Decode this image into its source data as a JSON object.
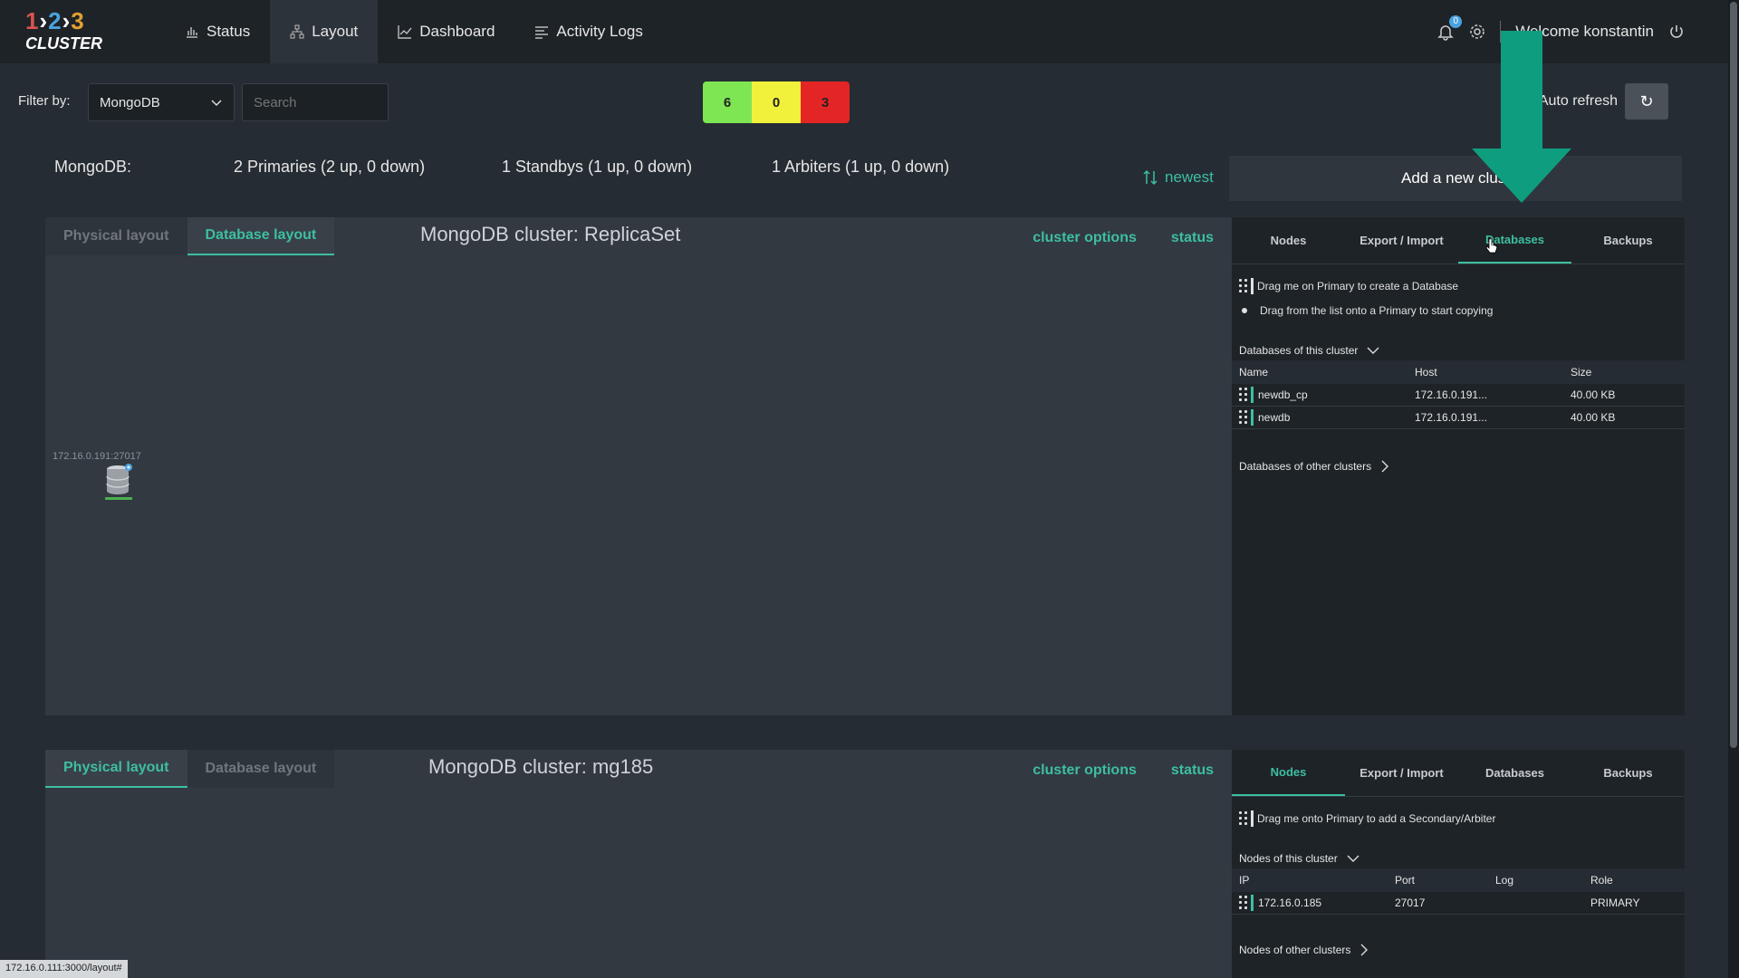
{
  "app": {
    "logo_nums": [
      "1",
      "2",
      "3"
    ],
    "logo_word": "CLUSTER"
  },
  "nav": {
    "items": [
      {
        "label": "Status",
        "icon": "bar-chart-icon"
      },
      {
        "label": "Layout",
        "icon": "sitemap-icon",
        "active": true
      },
      {
        "label": "Dashboard",
        "icon": "line-chart-icon"
      },
      {
        "label": "Activity Logs",
        "icon": "list-icon"
      }
    ],
    "notifications_count": "0",
    "welcome": "Welcome konstantin"
  },
  "filter": {
    "label": "Filter by:",
    "selected": "MongoDB",
    "search_placeholder": "Search",
    "counts": [
      {
        "value": "6",
        "color": "#7ee653"
      },
      {
        "value": "0",
        "color": "#f1f13c"
      },
      {
        "value": "3",
        "color": "#e42525"
      }
    ],
    "auto_refresh": "Auto refresh"
  },
  "summary": {
    "type": "MongoDB:",
    "primaries": "2 Primaries (2 up, 0 down)",
    "standbys": "1 Standbys (1 up, 0 down)",
    "arbiters": "1 Arbiters (1 up, 0 down)",
    "sort": "newest",
    "add_cluster": "Add a new clust"
  },
  "clusters": [
    {
      "layout_tabs": [
        "Physical layout",
        "Database layout"
      ],
      "active_layout": 1,
      "title": "MongoDB cluster: ReplicaSet",
      "options": "cluster options",
      "status": "status",
      "node_ip": "172.16.0.191:27017",
      "panel": {
        "tabs": [
          "Nodes",
          "Export / Import",
          "Databases",
          "Backups"
        ],
        "active_tab": 2,
        "hint1": "Drag me on Primary to create a Database",
        "hint2": "Drag from the list onto a Primary to start copying",
        "section": "Databases of this cluster",
        "columns": [
          "Name",
          "Host",
          "Size"
        ],
        "rows": [
          [
            "newdb_cp",
            "172.16.0.191...",
            "40.00 KB"
          ],
          [
            "newdb",
            "172.16.0.191...",
            "40.00 KB"
          ]
        ],
        "other": "Databases of other clusters"
      }
    },
    {
      "layout_tabs": [
        "Physical layout",
        "Database layout"
      ],
      "active_layout": 0,
      "title": "MongoDB cluster: mg185",
      "options": "cluster options",
      "status": "status",
      "panel": {
        "tabs": [
          "Nodes",
          "Export / Import",
          "Databases",
          "Backups"
        ],
        "active_tab": 0,
        "hint1": "Drag me onto Primary to add a Secondary/Arbiter",
        "section": "Nodes of this cluster",
        "columns": [
          "IP",
          "Port",
          "Log",
          "Role"
        ],
        "rows": [
          [
            "172.16.0.185",
            "27017",
            "",
            "PRIMARY"
          ]
        ],
        "other": "Nodes of other clusters"
      }
    }
  ],
  "statusbar": "172.16.0.111:3000/layout#",
  "colors": {
    "accent": "#3dbfa0",
    "arrow": "#0f9d7f"
  }
}
